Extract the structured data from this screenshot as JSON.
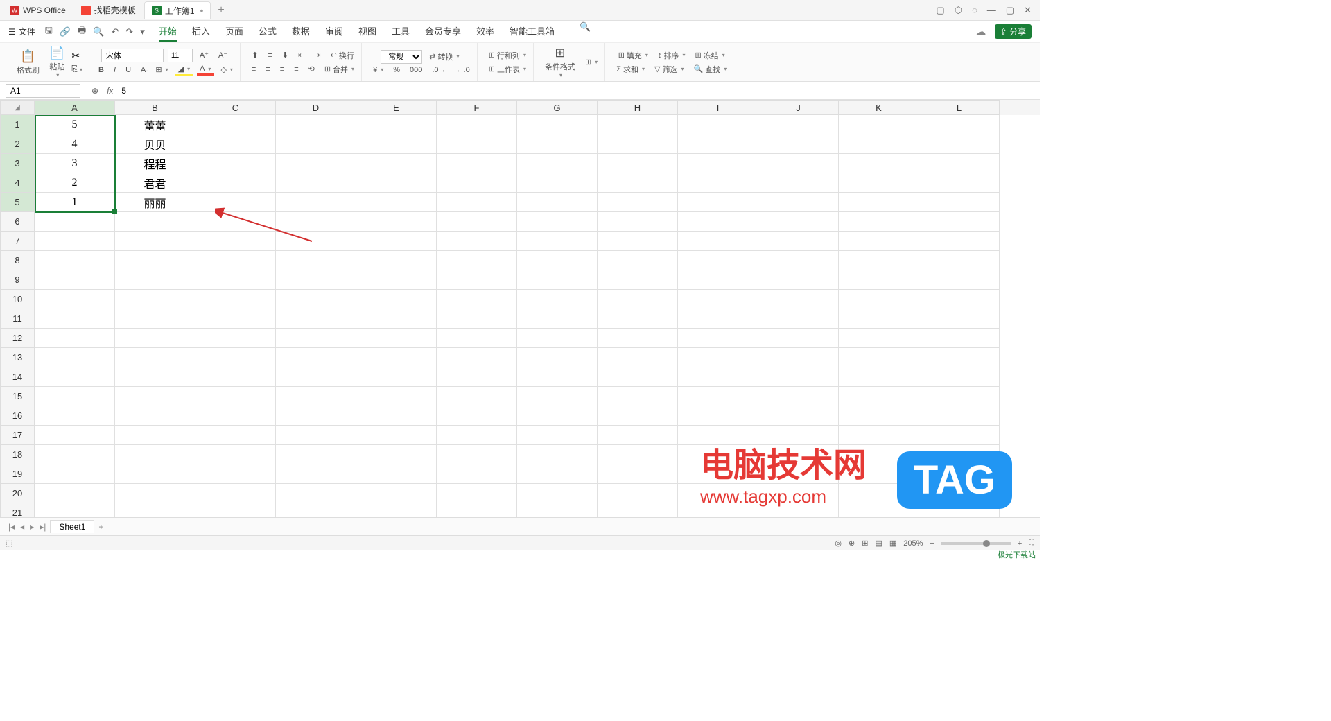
{
  "tabs": {
    "app": "WPS Office",
    "template": "找稻壳模板",
    "workbook": "工作簿1"
  },
  "menu": {
    "file": "文件",
    "items": [
      "开始",
      "插入",
      "页面",
      "公式",
      "数据",
      "审阅",
      "视图",
      "工具",
      "会员专享",
      "效率",
      "智能工具箱"
    ],
    "share": "分享"
  },
  "ribbon": {
    "brush": "格式刷",
    "paste": "粘贴",
    "font": "宋体",
    "size": "11",
    "wrap": "换行",
    "normal": "常规",
    "convert": "转换",
    "rowcol": "行和列",
    "worksheet": "工作表",
    "condfmt": "条件格式",
    "merge": "合并",
    "fill": "填充",
    "sort": "排序",
    "freeze": "冻结",
    "sum": "求和",
    "filter": "筛选",
    "find": "查找"
  },
  "formula": {
    "cellref": "A1",
    "value": "5"
  },
  "cols": [
    "A",
    "B",
    "C",
    "D",
    "E",
    "F",
    "G",
    "H",
    "I",
    "J",
    "K",
    "L"
  ],
  "rows": [
    "1",
    "2",
    "3",
    "4",
    "5",
    "6",
    "7",
    "8",
    "9",
    "10",
    "11",
    "12",
    "13",
    "14",
    "15",
    "16",
    "17",
    "18",
    "19",
    "20",
    "21"
  ],
  "cells": {
    "a": [
      "5",
      "4",
      "3",
      "2",
      "1"
    ],
    "b": [
      "蕾蕾",
      "贝贝",
      "程程",
      "君君",
      "丽丽"
    ]
  },
  "sheet": "Sheet1",
  "status": {
    "zoom": "205%"
  },
  "watermark": {
    "title": "电脑技术网",
    "url": "www.tagxp.com",
    "tag": "TAG",
    "corner": "极光下载站"
  }
}
